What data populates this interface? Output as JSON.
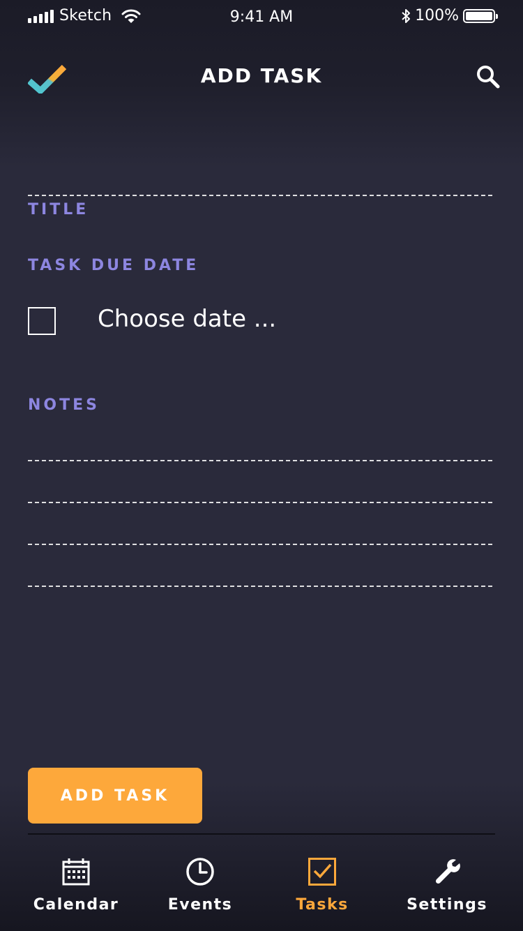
{
  "status_bar": {
    "carrier": "Sketch",
    "time": "9:41 AM",
    "battery": "100%"
  },
  "header": {
    "title": "ADD TASK"
  },
  "form": {
    "title_label": "TITLE",
    "due_date_label": "TASK DUE DATE",
    "choose_date": "Choose date ...",
    "notes_label": "NOTES"
  },
  "actions": {
    "add_task_label": "ADD TASK"
  },
  "tabbar": {
    "items": [
      {
        "label": "Calendar",
        "icon": "calendar-icon"
      },
      {
        "label": "Events",
        "icon": "clock-icon"
      },
      {
        "label": "Tasks",
        "icon": "checkbox-icon",
        "active": true
      },
      {
        "label": "Settings",
        "icon": "wrench-icon"
      }
    ]
  },
  "colors": {
    "accent": "#fda83b",
    "label_purple": "#8d86e0",
    "background": "#2a2a3b"
  }
}
